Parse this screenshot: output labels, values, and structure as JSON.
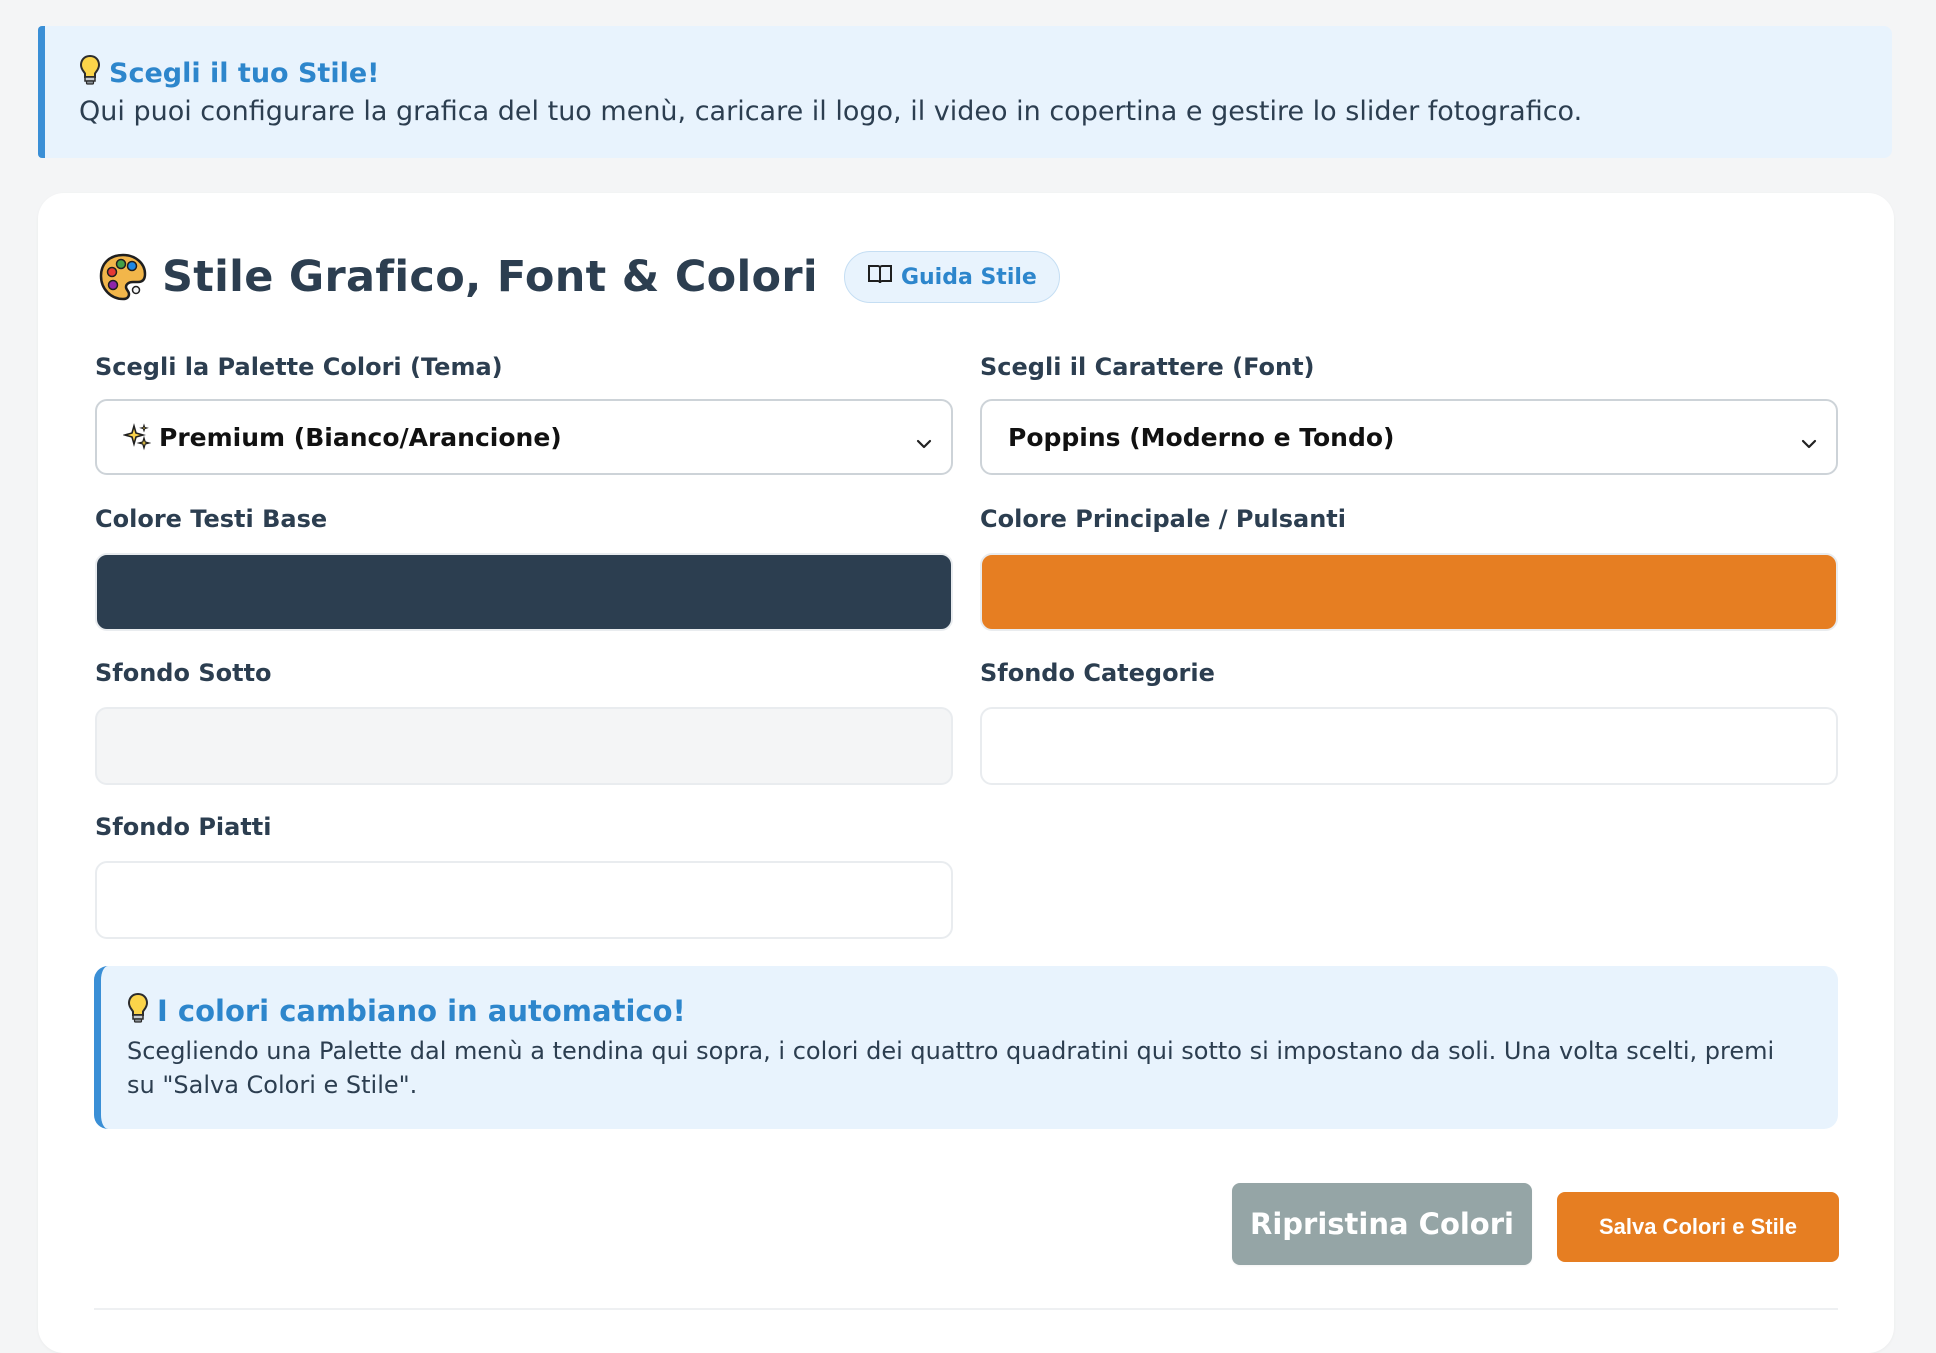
{
  "banner": {
    "title": "Scegli il tuo Stile!",
    "text": "Qui puoi configurare la grafica del tuo menù, caricare il logo, il video in copertina e gestire lo slider fotografico."
  },
  "card": {
    "title": "Stile Grafico, Font & Colori",
    "guide_label": "Guida Stile"
  },
  "fields": {
    "palette_label": "Scegli la Palette Colori (Tema)",
    "palette_value": "Premium (Bianco/Arancione)",
    "font_label": "Scegli il Carattere (Font)",
    "font_value": "Poppins (Moderno e Tondo)",
    "text_color_label": "Colore Testi Base",
    "primary_color_label": "Colore Principale / Pulsanti",
    "bg_bottom_label": "Sfondo Sotto",
    "bg_categories_label": "Sfondo Categorie",
    "bg_dishes_label": "Sfondo Piatti"
  },
  "colors": {
    "text_base": "#2c3e50",
    "primary": "#e67e22",
    "bg_bottom": "#f4f5f6",
    "bg_categories": "#ffffff",
    "bg_dishes": "#ffffff",
    "accent_blue": "#2d86cc"
  },
  "tip": {
    "title": "I colori cambiano in automatico!",
    "text": "Scegliendo una Palette dal menù a tendina qui sopra, i colori dei quattro quadratini qui sotto si impostano da soli. Una volta scelti, premi su \"Salva Colori e Stile\"."
  },
  "buttons": {
    "reset_label": "Ripristina Colori",
    "save_label": "Salva Colori e Stile"
  },
  "icons": {
    "banner": "lightbulb-icon",
    "title": "palette-icon",
    "guide": "book-icon",
    "palette_option": "sparkles-icon",
    "select": "chevron-down-icon",
    "tip": "lightbulb-icon"
  }
}
